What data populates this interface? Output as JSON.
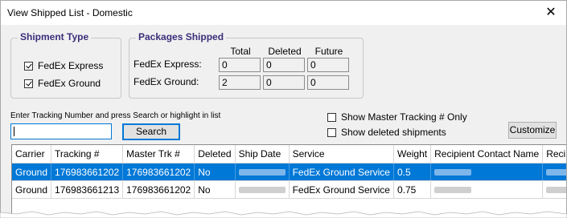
{
  "window": {
    "title": "View Shipped List - Domestic",
    "close_glyph": "✕"
  },
  "shipment_type": {
    "legend": "Shipment Type",
    "options": [
      {
        "label": "FedEx Express",
        "checked": true
      },
      {
        "label": "FedEx Ground",
        "checked": true
      }
    ]
  },
  "packages_shipped": {
    "legend": "Packages Shipped",
    "headers": [
      "Total",
      "Deleted",
      "Future"
    ],
    "rows": [
      {
        "label": "FedEx Express:",
        "total": "0",
        "deleted": "0",
        "future": "0"
      },
      {
        "label": "FedEx Ground:",
        "total": "2",
        "deleted": "0",
        "future": "0"
      }
    ]
  },
  "search": {
    "hint": "Enter Tracking Number and press Search or highlight in list",
    "value": "",
    "button_label": "Search"
  },
  "options": {
    "show_master": {
      "label": "Show Master Tracking # Only",
      "checked": false
    },
    "show_deleted": {
      "label": "Show deleted shipments",
      "checked": false
    }
  },
  "customize_label": "Customize",
  "grid": {
    "columns": [
      "Carrier",
      "Tracking #",
      "Master Trk #",
      "Deleted",
      "Ship Date",
      "Service",
      "Weight",
      "Recipient Contact Name",
      "Recipient Co"
    ],
    "rows": [
      {
        "carrier": "Ground",
        "tracking": "176983661202",
        "master": "176983661202",
        "deleted": "No",
        "service": "FedEx Ground Service",
        "weight": "0.5"
      },
      {
        "carrier": "Ground",
        "tracking": "176983661213",
        "master": "176983661202",
        "deleted": "No",
        "service": "FedEx Ground Service",
        "weight": "0.75"
      }
    ],
    "selected_row": 0
  },
  "colors": {
    "accent": "#0078d7",
    "legend": "#3a2f7a",
    "window_bg": "#f0f0f0"
  }
}
